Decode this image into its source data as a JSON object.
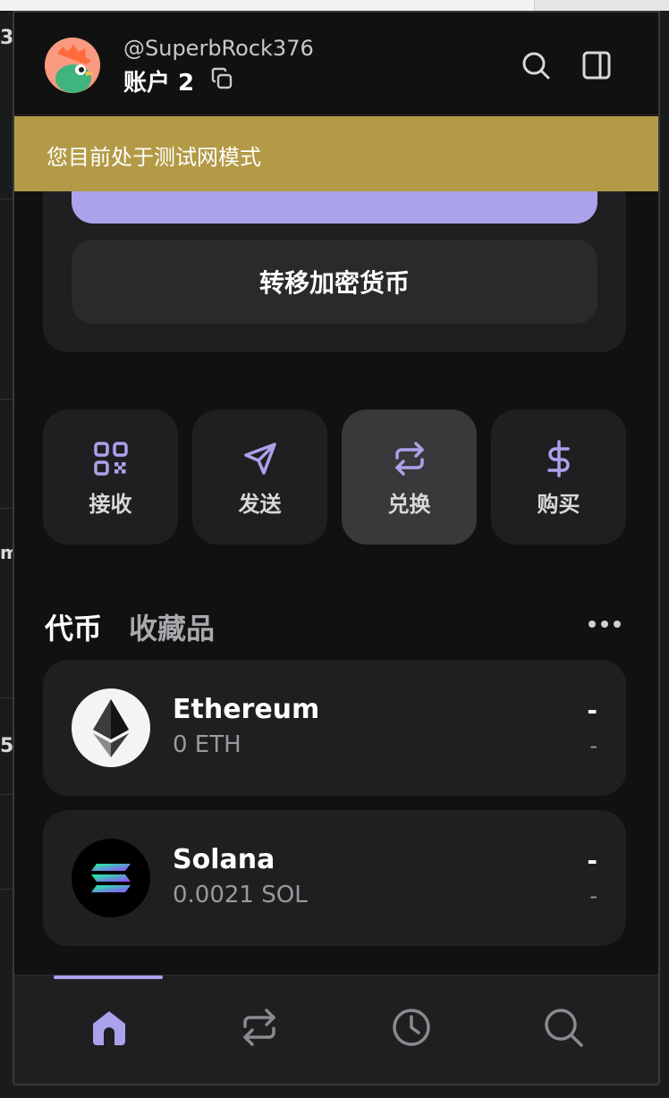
{
  "background": {
    "left_fragments": [
      "3",
      "ml",
      "5"
    ]
  },
  "header": {
    "username": "@SuperbRock376",
    "account_label": "账户 2"
  },
  "banner": {
    "text": "您目前处于测试网模式"
  },
  "card": {
    "primary_button": "",
    "secondary_button": "转移加密货币"
  },
  "actions": [
    {
      "label": "接收",
      "icon": "qr-code-icon"
    },
    {
      "label": "发送",
      "icon": "send-icon"
    },
    {
      "label": "兑换",
      "icon": "swap-icon",
      "active": true
    },
    {
      "label": "购买",
      "icon": "dollar-icon"
    }
  ],
  "tabs": {
    "tokens": "代币",
    "collectibles": "收藏品"
  },
  "tokens": [
    {
      "name": "Ethereum",
      "balance": "0 ETH",
      "value": "-",
      "change": "-"
    },
    {
      "name": "Solana",
      "balance": "0.0021 SOL",
      "value": "-",
      "change": "-"
    }
  ],
  "bottom_nav": [
    "home-icon",
    "swap-icon",
    "history-icon",
    "search-icon"
  ],
  "colors": {
    "accent": "#aba2ec",
    "banner": "#b39a46",
    "surface": "#1f1f21",
    "background": "#111112"
  }
}
